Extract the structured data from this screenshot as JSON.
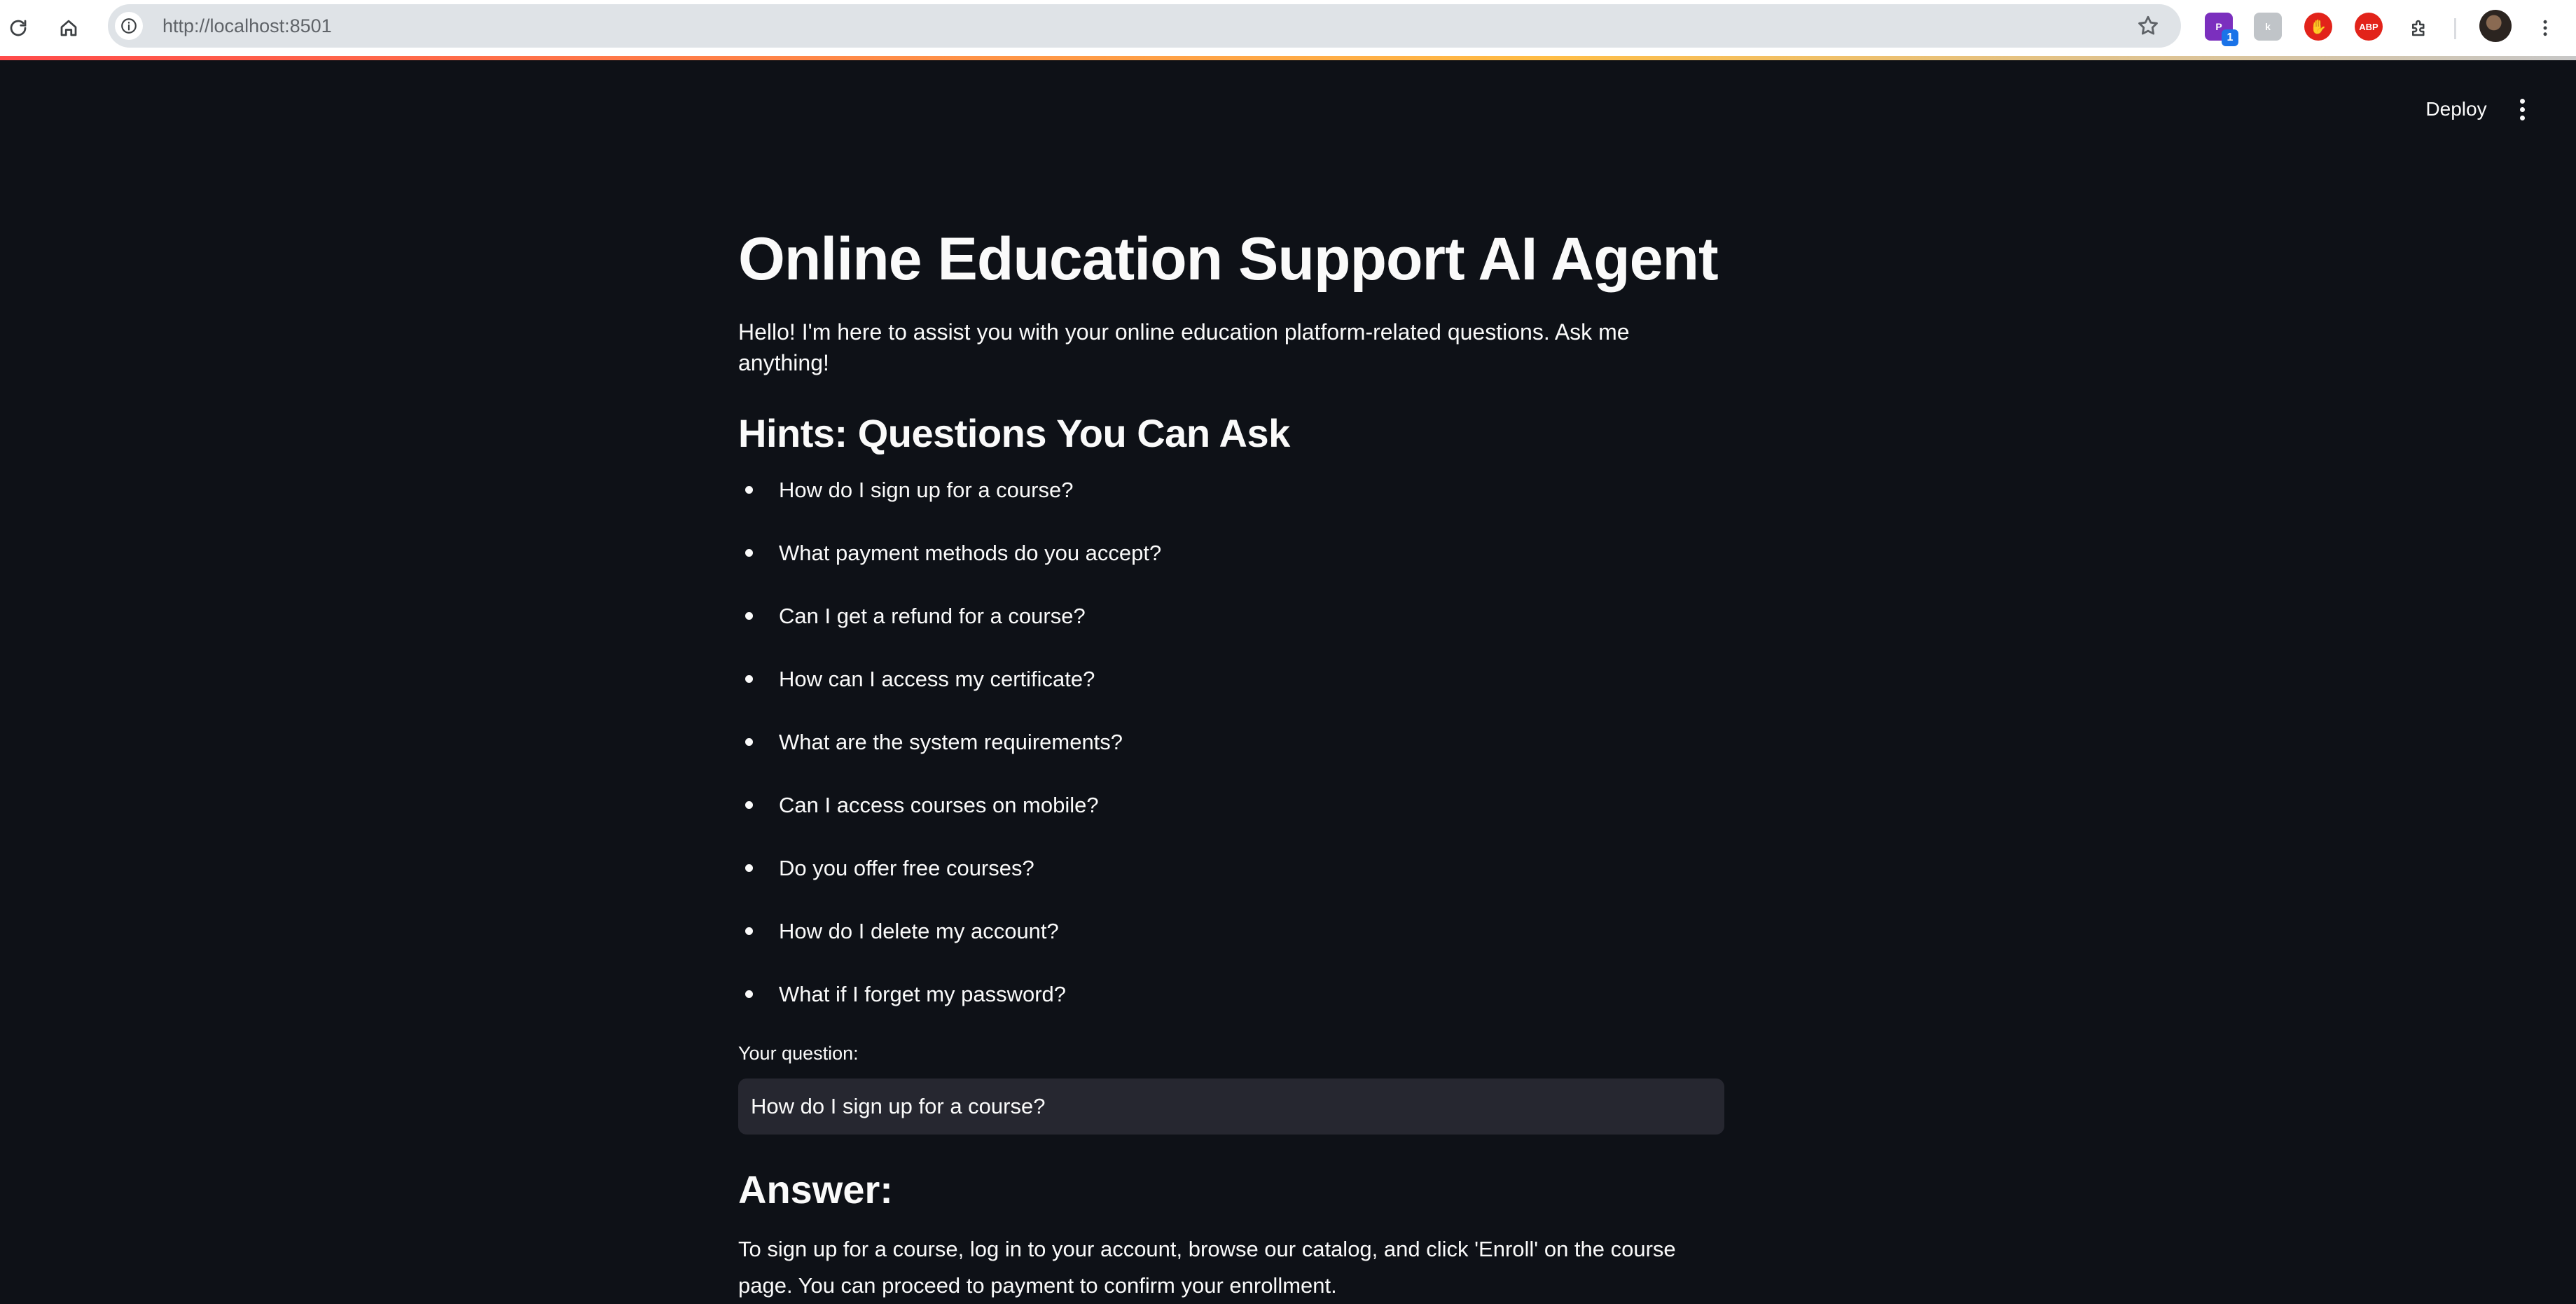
{
  "browser": {
    "url": "http://localhost:8501",
    "extensions": [
      {
        "name": "extension-purple",
        "label": "P",
        "badge": "1",
        "color": "#7b2fbe"
      },
      {
        "name": "extension-gray",
        "label": "k",
        "color": "#c0c4c8"
      },
      {
        "name": "extension-red-hand",
        "label": "✋",
        "color": "#e2231a"
      },
      {
        "name": "extension-adblock",
        "label": "ABP",
        "color": "#e2231a"
      }
    ]
  },
  "app": {
    "deploy_label": "Deploy",
    "title": "Online Education Support AI Agent",
    "intro": "Hello! I'm here to assist you with your online education platform-related questions. Ask me anything!",
    "hints_heading": "Hints: Questions You Can Ask",
    "hints": [
      "How do I sign up for a course?",
      "What payment methods do you accept?",
      "Can I get a refund for a course?",
      "How can I access my certificate?",
      "What are the system requirements?",
      "Can I access courses on mobile?",
      "Do you offer free courses?",
      "How do I delete my account?",
      "What if I forget my password?"
    ],
    "question_label": "Your question:",
    "question_value": "How do I sign up for a course?",
    "answer_heading": "Answer:",
    "answer_text": "To sign up for a course, log in to your account, browse our catalog, and click 'Enroll' on the course page. You can proceed to payment to confirm your enrollment."
  }
}
